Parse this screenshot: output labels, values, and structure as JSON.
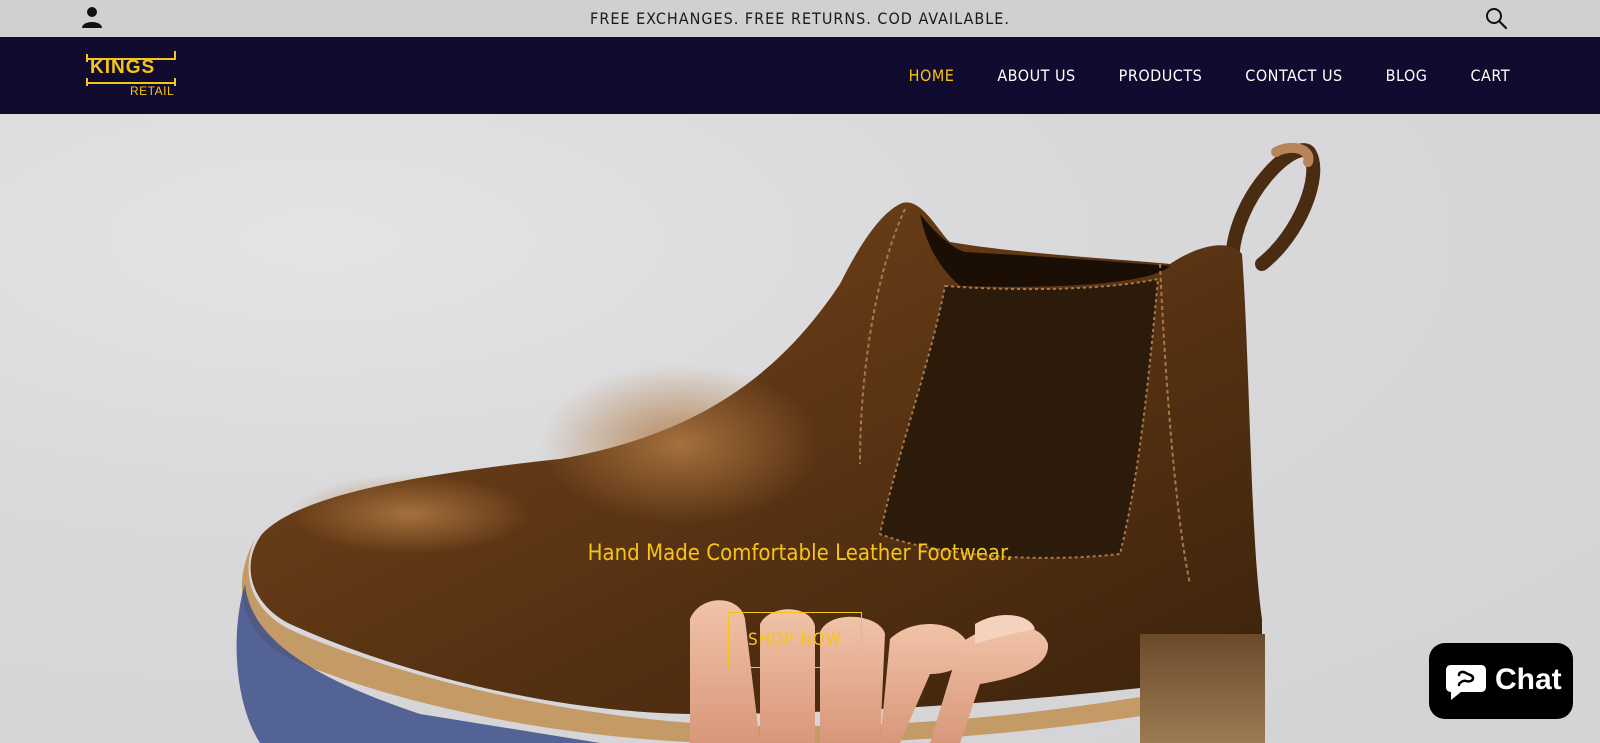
{
  "announcement": {
    "text": "FREE EXCHANGES. FREE RETURNS. COD AVAILABLE."
  },
  "icons": {
    "account": "user-icon",
    "search": "search-icon",
    "chat": "chat-bubble-icon"
  },
  "brand": {
    "logo_top": "KINGS",
    "logo_bottom": "RETAIL"
  },
  "nav": {
    "items": [
      {
        "label": "HOME",
        "active": true
      },
      {
        "label": "ABOUT US",
        "active": false
      },
      {
        "label": "PRODUCTS",
        "active": false
      },
      {
        "label": "CONTACT US",
        "active": false
      },
      {
        "label": "BLOG",
        "active": false
      },
      {
        "label": "CART",
        "active": false
      }
    ]
  },
  "hero": {
    "image": "brown-leather-chelsea-boot-held-in-hand",
    "tagline": "Hand Made Comfortable Leather Footwear.",
    "cta_label": "SHOP NOW"
  },
  "chat": {
    "label": "Chat"
  },
  "colors": {
    "accent": "#f5c518",
    "header_bg": "#110c2f",
    "announcement_bg": "#d0d0d0",
    "chat_bg": "#000000"
  }
}
